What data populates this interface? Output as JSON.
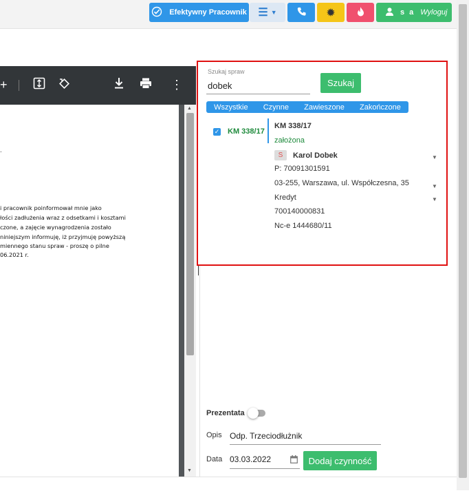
{
  "topbar": {
    "efektywny_label": "Efektywny Pracownik",
    "menu_icon": "hamburger-chevron-icon",
    "phone_icon": "phone-icon",
    "gear_icon": "gear-icon",
    "fire_icon": "fire-icon",
    "user_icon": "user-icon",
    "user_name": "s a",
    "logout_label": "Wyloguj",
    "colors": {
      "blue": "#2f96e8",
      "yellow": "#f5c518",
      "red": "#f0506e",
      "green": "#3dbd6e"
    }
  },
  "pdf": {
    "toolbar_icons": [
      "plus-icon",
      "fit-page-icon",
      "rotate-icon",
      "download-icon",
      "print-icon",
      "more-icon"
    ],
    "lines": [
      "i pracownik poinformował mnie jako",
      "łości zadłużenia wraz z odsetkami i kosztami",
      "czone, a zajęcie wynagrodzenia zostało",
      "niniejszym informuję, iż przyjmuję powyższą",
      "miennego stanu spraw - proszę o pilne",
      "06.2021 r."
    ]
  },
  "search": {
    "label": "Szukaj spraw",
    "value": "dobek",
    "button": "Szukaj",
    "tabs": [
      "Wszystkie",
      "Czynne",
      "Zawieszone",
      "Zakończone"
    ]
  },
  "case": {
    "id": "KM 338/17",
    "status": "założona",
    "person_badge": "S",
    "person_name": "Karol Dobek",
    "pesel": "P: 70091301591",
    "address": "03-255, Warszawa, ul. Współczesna, 35",
    "type": "Kredyt",
    "account": "700140000831",
    "case_ref": "Nc-e 1444680/11"
  },
  "form": {
    "prezentata_label": "Prezentata",
    "opis_label": "Opis",
    "opis_value": "Odp. Trzeciodłużnik",
    "data_label": "Data",
    "data_value": "03.03.2022",
    "add_button": "Dodaj czynność"
  }
}
